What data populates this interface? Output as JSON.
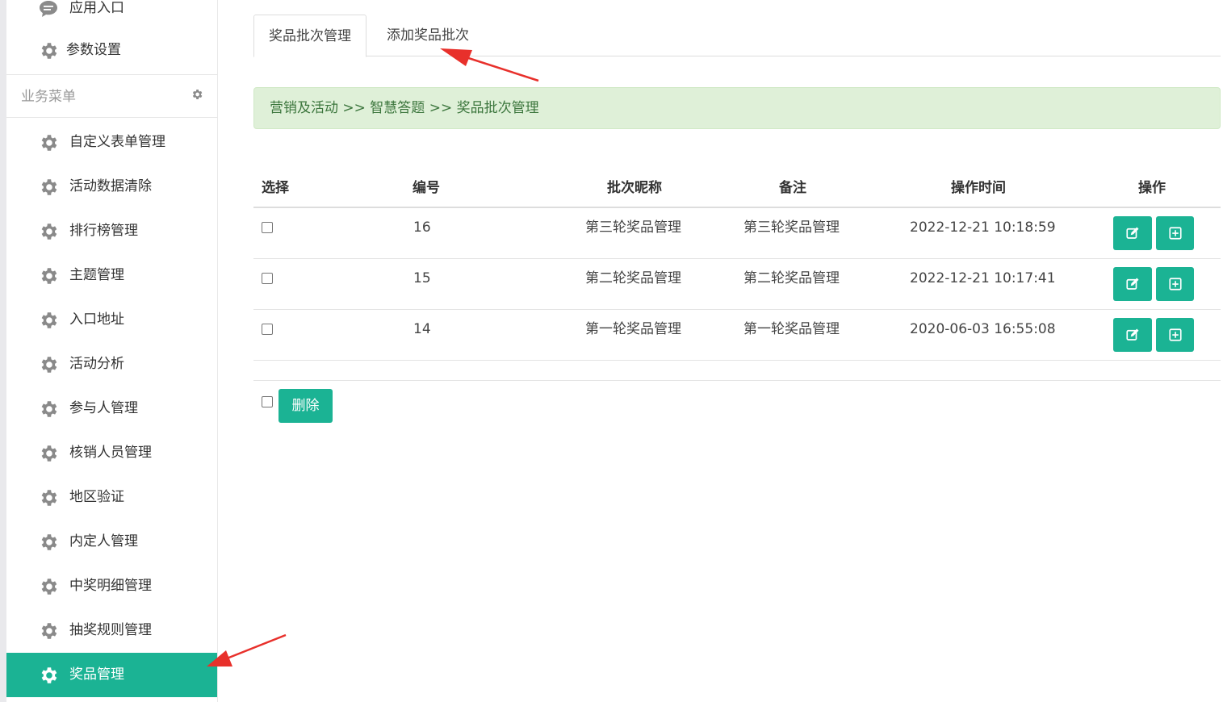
{
  "sidebar": {
    "top_items": [
      {
        "label": "应用入口",
        "icon": "chat-bubble-icon"
      },
      {
        "label": "参数设置",
        "icon": "gear-icon"
      }
    ],
    "menu_header": {
      "label": "业务菜单",
      "icon": "gear-icon"
    },
    "items": [
      {
        "label": "自定义表单管理",
        "icon": "gear-icon"
      },
      {
        "label": "活动数据清除",
        "icon": "gear-icon"
      },
      {
        "label": "排行榜管理",
        "icon": "gear-icon"
      },
      {
        "label": "主题管理",
        "icon": "gear-icon"
      },
      {
        "label": "入口地址",
        "icon": "gear-icon"
      },
      {
        "label": "活动分析",
        "icon": "gear-icon"
      },
      {
        "label": "参与人管理",
        "icon": "gear-icon"
      },
      {
        "label": "核销人员管理",
        "icon": "gear-icon"
      },
      {
        "label": "地区验证",
        "icon": "gear-icon"
      },
      {
        "label": "内定人管理",
        "icon": "gear-icon"
      },
      {
        "label": "中奖明细管理",
        "icon": "gear-icon"
      },
      {
        "label": "抽奖规则管理",
        "icon": "gear-icon"
      },
      {
        "label": "奖品管理",
        "icon": "gear-icon",
        "active": true
      }
    ]
  },
  "tabs": [
    {
      "label": "奖品批次管理",
      "active": true
    },
    {
      "label": "添加奖品批次",
      "active": false
    }
  ],
  "breadcrumb": "营销及活动 >> 智慧答题 >> 奖品批次管理",
  "table": {
    "headers": [
      "选择",
      "编号",
      "批次昵称",
      "备注",
      "操作时间",
      "操作"
    ],
    "rows": [
      {
        "id": "16",
        "name": "第三轮奖品管理",
        "remark": "第三轮奖品管理",
        "time": "2022-12-21 10:18:59"
      },
      {
        "id": "15",
        "name": "第二轮奖品管理",
        "remark": "第二轮奖品管理",
        "time": "2022-12-21 10:17:41"
      },
      {
        "id": "14",
        "name": "第一轮奖品管理",
        "remark": "第一轮奖品管理",
        "time": "2020-06-03 16:55:08"
      }
    ],
    "row_actions": [
      {
        "icon": "edit-icon"
      },
      {
        "icon": "plus-square-icon"
      }
    ]
  },
  "delete_button": "删除",
  "colors": {
    "accent": "#1bb394",
    "breadcrumb_bg": "#dff0d8",
    "breadcrumb_text": "#3c763d",
    "annotation_arrow": "#e8302b"
  }
}
